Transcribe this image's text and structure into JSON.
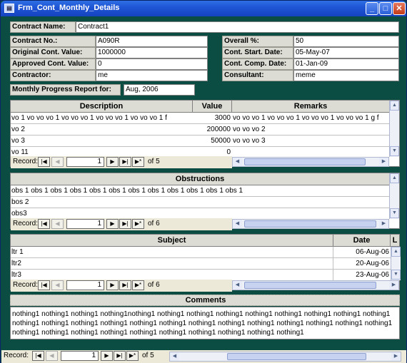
{
  "window": {
    "title": "Frm_Cont_Monthly_Details",
    "controls": [
      "_",
      "□",
      "✕"
    ]
  },
  "fields": {
    "contract_name": {
      "label": "Contract Name:",
      "value": "Contract1"
    },
    "contract_no": {
      "label": "Contract No.:",
      "value": "A090R"
    },
    "original_value": {
      "label": "Original Cont. Value:",
      "value": "1000000"
    },
    "approved_value": {
      "label": "Approved Cont. Value:",
      "value": "0"
    },
    "contractor": {
      "label": "Contractor:",
      "value": "me"
    },
    "overall": {
      "label": "Overall %:",
      "value": "50"
    },
    "start_date": {
      "label": "Cont. Start. Date:",
      "value": "05-May-07"
    },
    "comp_date": {
      "label": "Cont. Comp. Date:",
      "value": "01-Jan-09"
    },
    "consultant": {
      "label": "Consultant:",
      "value": "meme"
    },
    "report_for": {
      "label": "Monthly Progress Report for:",
      "value": "Aug, 2006"
    }
  },
  "variations": {
    "headers": [
      "Description",
      "Value",
      "Remarks"
    ],
    "rows": [
      {
        "description": "vo 1 vo vo vo 1 vo vo vo 1 vo vo vo 1 vo vo vo 1 f",
        "value": "3000",
        "remarks": "vo vo vo 1 vo vo vo 1 vo vo vo 1 vo vo vo 1 g f"
      },
      {
        "description": "vo 2",
        "value": "200000",
        "remarks": "vo vo vo 2"
      },
      {
        "description": "vo 3",
        "value": "50000",
        "remarks": "vo vo vo 3"
      },
      {
        "description": "vo 11",
        "value": "0",
        "remarks": ""
      }
    ],
    "nav": {
      "record_label": "Record:",
      "current": "1",
      "of_label": "of 5"
    }
  },
  "obstructions": {
    "header": "Obstructions",
    "rows": [
      "obs 1 obs 1 obs 1 obs 1 obs 1 obs 1 obs 1 obs 1 obs 1 obs 1 obs 1 obs 1",
      "bos 2",
      "obs3"
    ],
    "nav": {
      "record_label": "Record:",
      "current": "1",
      "of_label": "of 6"
    }
  },
  "letters": {
    "headers": [
      "Subject",
      "Date",
      "L"
    ],
    "rows": [
      {
        "subject": "ltr 1",
        "date": "06-Aug-06"
      },
      {
        "subject": "ltr2",
        "date": "20-Aug-06"
      },
      {
        "subject": "ltr3",
        "date": "23-Aug-06"
      }
    ],
    "nav": {
      "record_label": "Record:",
      "current": "1",
      "of_label": "of 6"
    }
  },
  "comments": {
    "header": "Comments",
    "text": "nothing1 nothing1 nothing1 nothing1nothing1 nothing1 nothing1 nothing1 nothing1 nothing1 nothing1 nothing1 nothing1 nothing1 nothing1 nothing1 nothing1 nothing1 nothing1 nothing1 nothing1 nothing1 nothing1 nothing1 nothing1 nothing1 nothing1 nothing1 nothing1 nothing1 nothing1 nothing1 nothing1 nothing1 nothing1 nothing1"
  },
  "main_nav": {
    "record_label": "Record:",
    "current": "1",
    "of_label": "of 5"
  },
  "nav_glyphs": {
    "first": "|◀",
    "prev": "◀",
    "next": "▶",
    "last": "▶|",
    "new": "▶*"
  }
}
